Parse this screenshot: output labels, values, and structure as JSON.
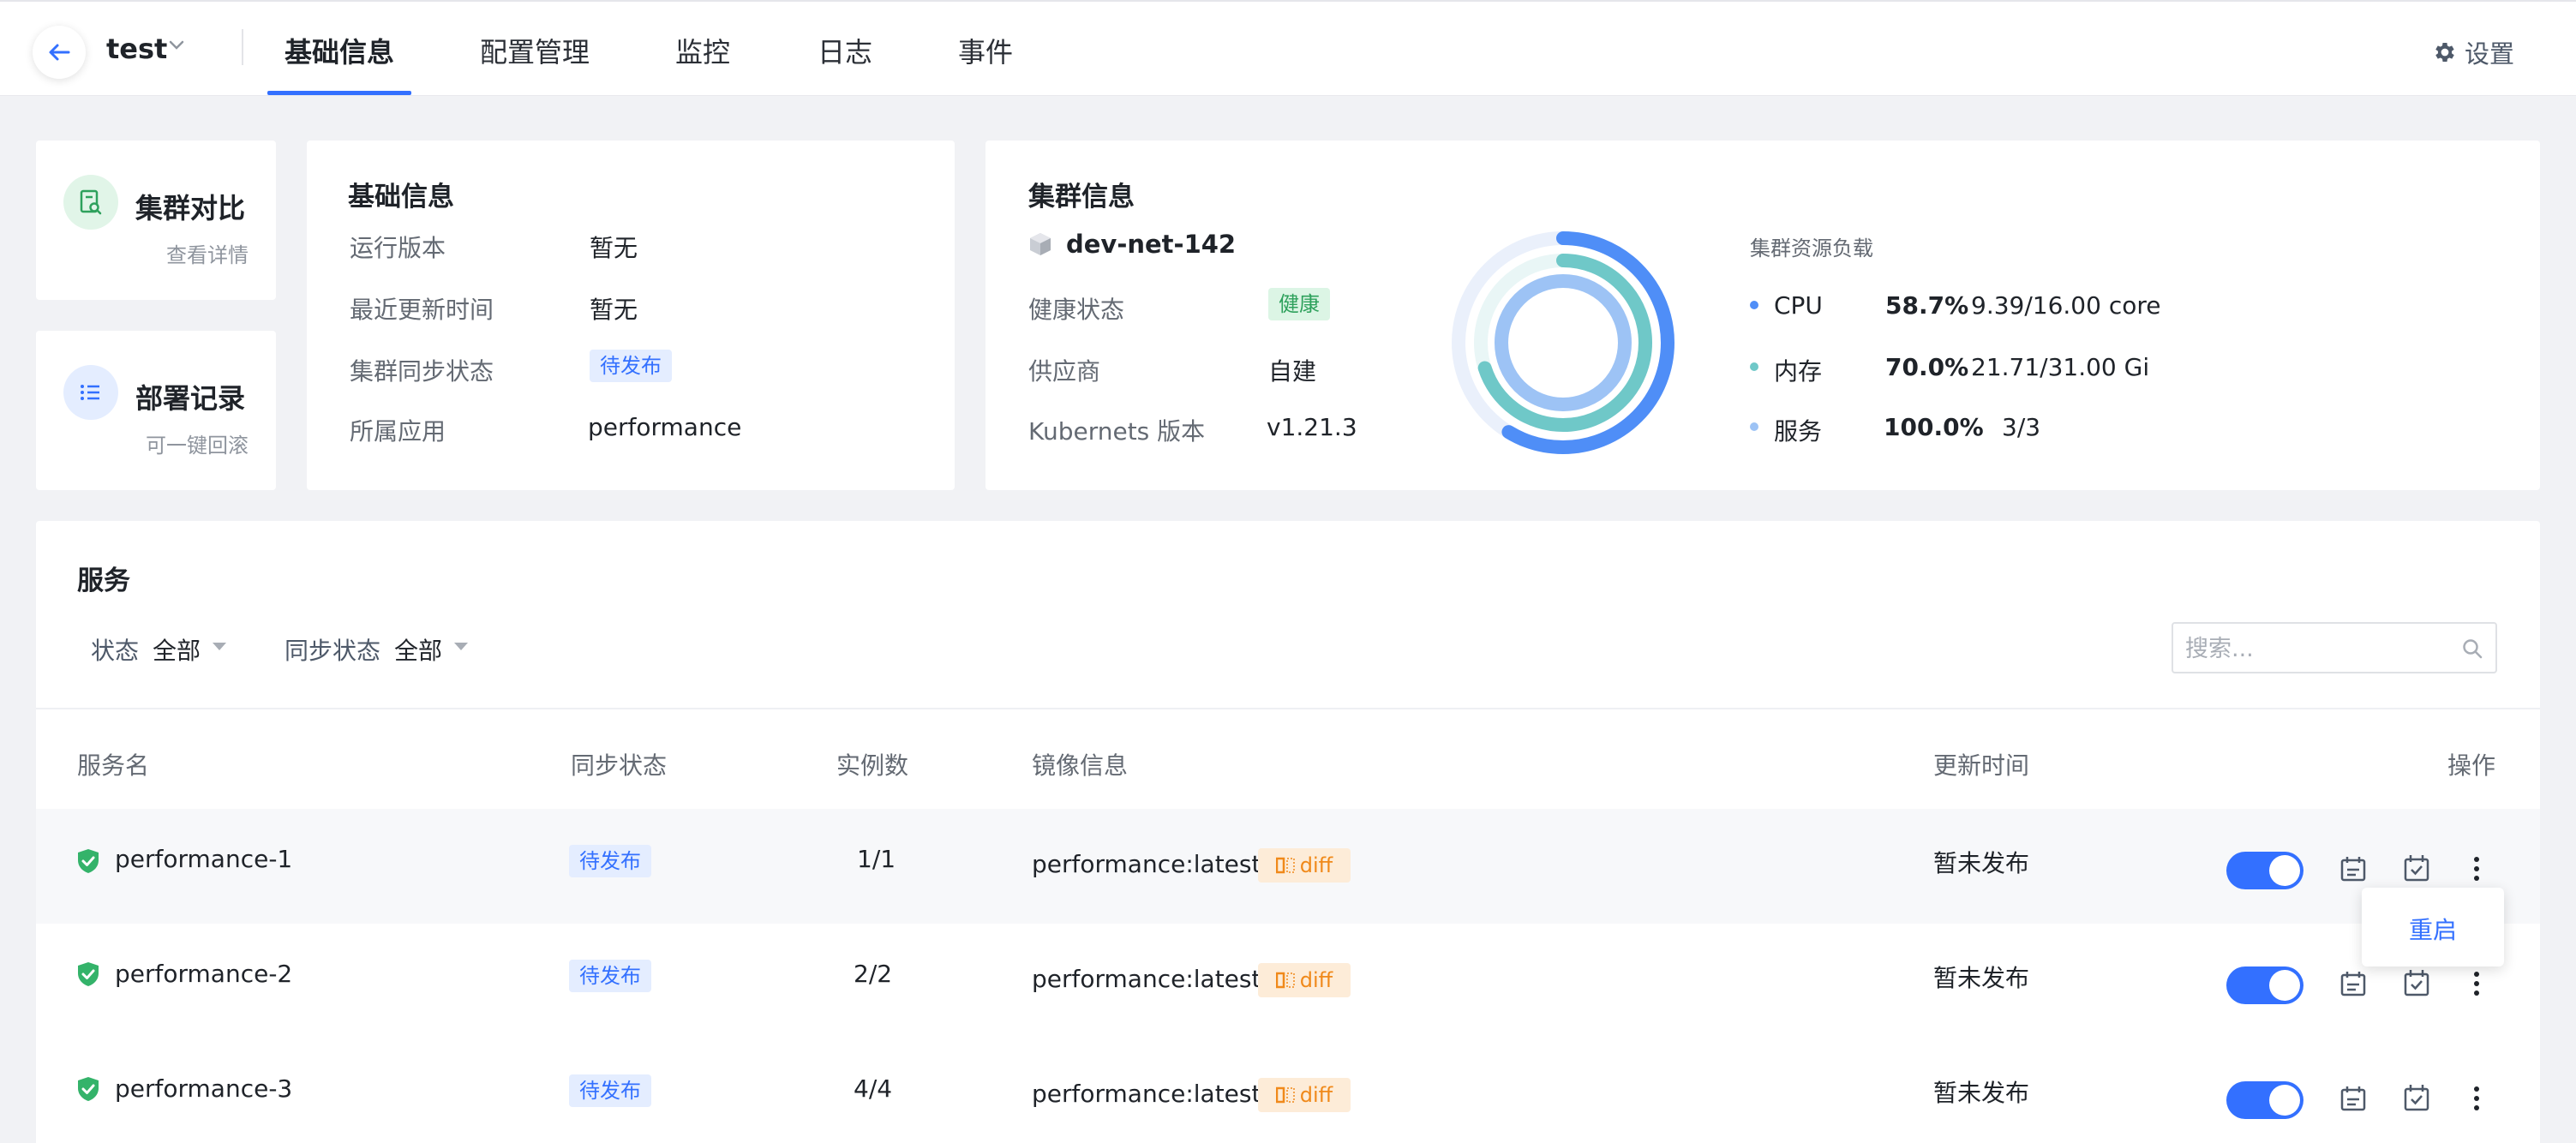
{
  "header": {
    "project": "test",
    "tabs": [
      {
        "label": "基础信息",
        "active": true
      },
      {
        "label": "配置管理",
        "active": false
      },
      {
        "label": "监控",
        "active": false
      },
      {
        "label": "日志",
        "active": false
      },
      {
        "label": "事件",
        "active": false
      }
    ],
    "settings_label": "设置"
  },
  "quick_cards": [
    {
      "title": "集群对比",
      "sub": "查看详情",
      "icon": "document-search-icon",
      "color": "#2ea15c"
    },
    {
      "title": "部署记录",
      "sub": "可一键回滚",
      "icon": "list-icon",
      "color": "#3370ff"
    }
  ],
  "basic_info": {
    "title": "基础信息",
    "rows": [
      {
        "label": "运行版本",
        "value": "暂无"
      },
      {
        "label": "最近更新时间",
        "value": "暂无"
      },
      {
        "label": "集群同步状态",
        "value": "待发布"
      },
      {
        "label": "所属应用",
        "value": "performance"
      }
    ]
  },
  "cluster_info": {
    "title": "集群信息",
    "cluster_name": "dev-net-142",
    "rows": [
      {
        "label": "健康状态",
        "value": "健康"
      },
      {
        "label": "供应商",
        "value": "自建"
      },
      {
        "label": "Kubernets 版本",
        "value": "v1.21.3"
      }
    ],
    "load_title": "集群资源负载",
    "load": [
      {
        "name": "CPU",
        "pct": "58.7%",
        "fraction": 0.587,
        "value": "9.39/16.00 core",
        "color": "#4f8ef7"
      },
      {
        "name": "内存",
        "pct": "70.0%",
        "fraction": 0.7,
        "value": "21.71/31.00 Gi",
        "color": "#6fc8c8"
      },
      {
        "name": "服务",
        "pct": "100.0%",
        "fraction": 1.0,
        "value": "3/3",
        "color": "#9dc3f5"
      }
    ]
  },
  "services": {
    "title": "服务",
    "filters": [
      {
        "label": "状态",
        "value": "全部"
      },
      {
        "label": "同步状态",
        "value": "全部"
      }
    ],
    "search_placeholder": "搜索...",
    "columns": [
      "服务名",
      "同步状态",
      "实例数",
      "镜像信息",
      "更新时间",
      "操作"
    ],
    "rows": [
      {
        "name": "performance-1",
        "sync": "待发布",
        "instances": "1/1",
        "image": "performance:latest",
        "diff": "diff",
        "updated": "暂未发布",
        "enabled": true
      },
      {
        "name": "performance-2",
        "sync": "待发布",
        "instances": "2/2",
        "image": "performance:latest",
        "diff": "diff",
        "updated": "暂未发布",
        "enabled": true
      },
      {
        "name": "performance-3",
        "sync": "待发布",
        "instances": "4/4",
        "image": "performance:latest",
        "diff": "diff",
        "updated": "暂未发布",
        "enabled": true
      }
    ],
    "menu_item": "重启"
  }
}
